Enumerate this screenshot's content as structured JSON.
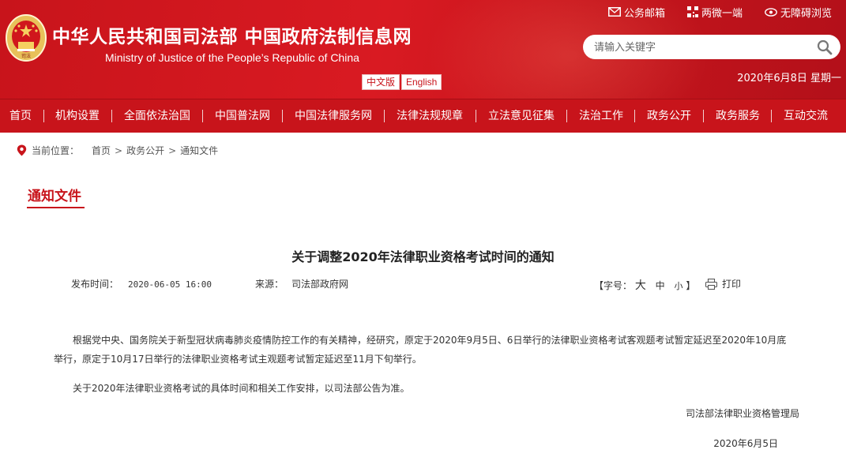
{
  "header": {
    "title_cn": "中华人民共和国司法部  中国政府法制信息网",
    "title_en": "Ministry of Justice of the People’s Republic of China",
    "lang_cn": "中文版",
    "lang_en": "English",
    "emblem_text": "司法",
    "toplinks": {
      "mail": "公务邮箱",
      "weixin": "两微一端",
      "accessible": "无障碍浏览"
    },
    "search_placeholder": "请输入关键字",
    "date": "2020年6月8日 星期一"
  },
  "nav": [
    "首页",
    "机构设置",
    "全面依法治国",
    "中国普法网",
    "中国法律服务网",
    "法律法规规章",
    "立法意见征集",
    "法治工作",
    "政务公开",
    "政务服务",
    "互动交流"
  ],
  "breadcrumb": {
    "prefix": "当前位置：",
    "items": [
      "首页",
      "政务公开",
      "通知文件"
    ],
    "sep": ">"
  },
  "section_title": "通知文件",
  "article": {
    "title": "关于调整2020年法律职业资格考试时间的通知",
    "pub_label": "发布时间：",
    "pub_value": "2020-06-05 16:00",
    "src_label": "来源：",
    "src_value": "司法部政府网",
    "font_open": "【字号：",
    "font_large": "大",
    "font_medium": "中",
    "font_small": "小",
    "font_close": "】",
    "print": "打印",
    "para1": "根据党中央、国务院关于新型冠状病毒肺炎疫情防控工作的有关精神，经研究，原定于2020年9月5日、6日举行的法律职业资格考试客观题考试暂定延迟至2020年10月底举行，原定于10月17日举行的法律职业资格考试主观题考试暂定延迟至11月下旬举行。",
    "para2": "关于2020年法律职业资格考试的具体时间和相关工作安排，以司法部公告为准。",
    "signature": "司法部法律职业资格管理局",
    "sign_date": "2020年6月5日"
  },
  "colors": {
    "brand_red": "#c8141b",
    "white": "#ffffff"
  }
}
